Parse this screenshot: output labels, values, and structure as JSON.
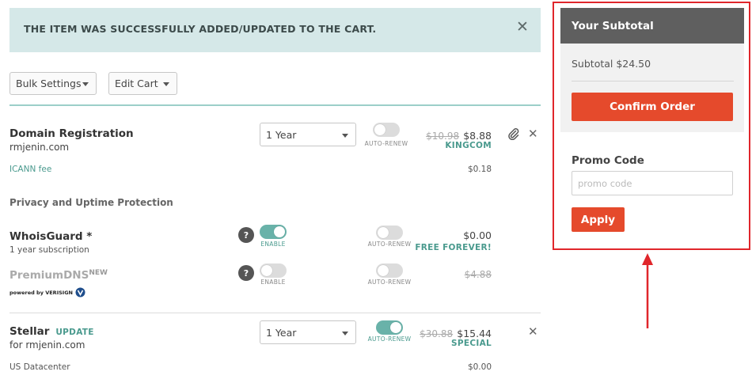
{
  "alert": {
    "message": "THE ITEM WAS SUCCESSFULLY ADDED/UPDATED TO THE CART.",
    "close": "✕"
  },
  "toolbar": {
    "bulk_settings": "Bulk Settings",
    "edit_cart": "Edit Cart"
  },
  "domain": {
    "title": "Domain Registration",
    "name": "rmjenin.com",
    "term": "1 Year",
    "auto_renew_label": "AUTO-RENEW",
    "auto_renew_on": false,
    "old_price": "$10.98",
    "price": "$8.88",
    "tag": "KINGCOM",
    "fee_label": "ICANN fee",
    "fee_price": "$0.18"
  },
  "privacy": {
    "section_title": "Privacy and Uptime Protection",
    "whoisguard": {
      "title": "WhoisGuard *",
      "subtitle": "1 year subscription",
      "help": "?",
      "enable_label": "ENABLE",
      "enabled": true,
      "auto_renew_label": "AUTO-RENEW",
      "price": "$0.00",
      "tag": "FREE FOREVER!"
    },
    "premiumdns": {
      "title": "PremiumDNS",
      "badge": "NEW",
      "powered_by": "powered by VERISIGN",
      "help": "?",
      "enable_label": "ENABLE",
      "enabled": false,
      "auto_renew_label": "AUTO-RENEW",
      "price": "$4.88"
    }
  },
  "hosting": {
    "title": "Stellar",
    "update_label": "UPDATE",
    "for_domain": "for rmjenin.com",
    "term": "1 Year",
    "auto_renew_label": "AUTO-RENEW",
    "auto_renew_on": true,
    "old_price": "$30.88",
    "price": "$15.44",
    "tag": "SPECIAL",
    "datacenter": "US Datacenter",
    "datacenter_price": "$0.00"
  },
  "sidebar": {
    "header": "Your Subtotal",
    "subtotal": "Subtotal $24.50",
    "confirm": "Confirm Order",
    "promo_label": "Promo Code",
    "promo_placeholder": "promo code",
    "apply": "Apply"
  },
  "colors": {
    "accent_red": "#e54a2c",
    "teal": "#4a9a8e",
    "highlight_box": "#e0262b",
    "alert_bg": "#d5e8e8"
  }
}
